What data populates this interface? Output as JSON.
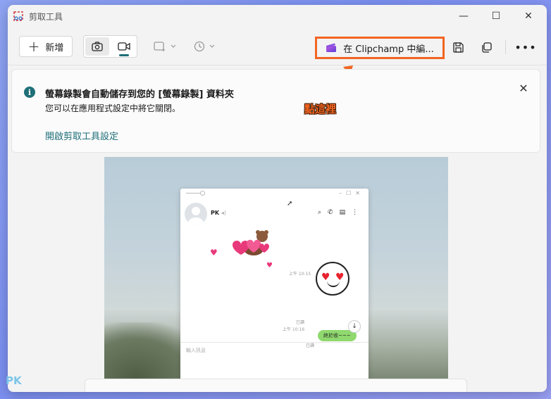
{
  "window": {
    "title": "剪取工具",
    "minimize_glyph": "—",
    "maximize_glyph": "☐",
    "close_glyph": "✕"
  },
  "toolbar": {
    "new_label": "新增",
    "new_glyph": "+",
    "clipchamp_label": "在 Clipchamp 中編...",
    "more_glyph": "•••",
    "icons": [
      "camera-icon",
      "video-camera-icon",
      "rectangle-snip-icon",
      "timer-icon",
      "save-icon",
      "copy-icon",
      "more-icon"
    ]
  },
  "banner": {
    "info_glyph": "i",
    "title": "螢幕錄製會自動儲存到您的 [螢幕錄製] 資料夾",
    "message": "您可以在應用程式設定中將它關閉。",
    "link": "開啟剪取工具設定",
    "close_glyph": "✕"
  },
  "annotation": {
    "text": "點這裡",
    "color": "#f26522"
  },
  "preview": {
    "chat_name": "PK",
    "timestamp_1": "上午 10:15",
    "read_label_1": "已讀",
    "timestamp_2": "上午 10:16",
    "read_label_2": "已讀",
    "bubble_text": "終於收~~~",
    "input_placeholder": "輸入訊息"
  },
  "watermark": {
    "text": "PK"
  },
  "colors": {
    "accent": "#1f6f78",
    "highlight": "#f26522"
  }
}
